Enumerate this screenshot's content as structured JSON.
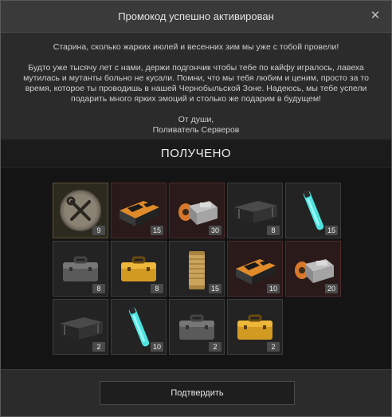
{
  "dialog": {
    "title": "Промокод успешно активирован",
    "close_label": "✕",
    "message": {
      "line1": "Старина, сколько жарких июлей и весенних зим мы уже с тобой провели!",
      "paragraph2": "Будто уже тысячу лет с нами, держи подгончик чтобы тебе по кайфу игралось, лавеха мутилась и мутанты больно не кусали. Помни, что мы тебя любим и ценим, просто за то время, которое ты проводишь в нашей Чернобыльской Зоне. Надеюсь, мы тебе успели подарить много ярких эмоций и столько же подарим в будущем!",
      "sign1": "От души,",
      "sign2": "Поливатель Серверов"
    },
    "received_label": "ПОЛУЧЕНО",
    "confirm_label": "Подтвердить"
  },
  "items": [
    {
      "icon": "wrench-screwdriver-badge-icon",
      "count": "9",
      "style": "gold"
    },
    {
      "icon": "orange-black-ammo-box-icon",
      "count": "15",
      "style": "red"
    },
    {
      "icon": "orange-crate-open-icon",
      "count": "30",
      "style": "red"
    },
    {
      "icon": "black-ammo-crate-icon",
      "count": "8",
      "style": "normal"
    },
    {
      "icon": "cyan-glow-stick-icon",
      "count": "15",
      "style": "normal"
    },
    {
      "icon": "gray-hard-case-icon",
      "count": "8",
      "style": "normal"
    },
    {
      "icon": "gold-hard-case-icon",
      "count": "8",
      "style": "normal"
    },
    {
      "icon": "brass-canister-icon",
      "count": "15",
      "style": "normal"
    },
    {
      "icon": "orange-black-ammo-box-icon",
      "count": "10",
      "style": "red"
    },
    {
      "icon": "orange-crate-open-icon",
      "count": "20",
      "style": "red"
    },
    {
      "icon": "black-ammo-crate-icon",
      "count": "2",
      "style": "normal"
    },
    {
      "icon": "cyan-glow-stick-icon",
      "count": "10",
      "style": "normal"
    },
    {
      "icon": "gray-hard-case-icon",
      "count": "2",
      "style": "normal"
    },
    {
      "icon": "gold-hard-case-icon",
      "count": "2",
      "style": "normal"
    }
  ]
}
